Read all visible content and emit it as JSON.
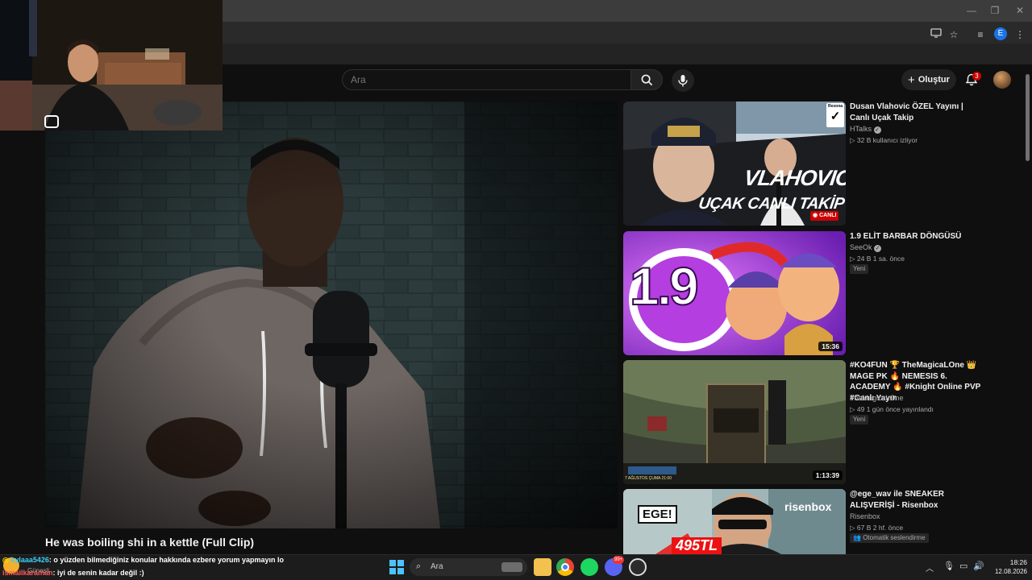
{
  "youtube": {
    "search": {
      "placeholder": "Ara"
    },
    "create_label": "Oluştur",
    "notifications_count": "3"
  },
  "browser": {
    "profile_initial": "E"
  },
  "main_video": {
    "title": "He was boiling shi in a kettle (Full Clip)"
  },
  "sidebar": {
    "videos": [
      {
        "title": "Dusan Vlahovic ÖZEL Yayını | Canlı Uçak Takip",
        "channel": "HTalks",
        "verified": true,
        "meta": "32 B kullanıcı izliyor",
        "thumb_text_1": "VLAHOVIC",
        "thumb_text_2": "UÇAK CANLI TAKİP",
        "live_label": "CANLI",
        "brand_text": "Rexona"
      },
      {
        "title": "1.9 ELİT BARBAR DÖNGÜSÜ",
        "channel": "SeeOk",
        "verified": true,
        "meta": "24 B   1 sa. önce",
        "badge": "Yeni",
        "thumb_text": "1.9",
        "duration": "15:36"
      },
      {
        "title": "#KO4FUN 🏆 TheMagicaLOne 👑 MAGE PK 🔥 NEMESIS 6. ACADEMY 🔥 #Knight Online PVP #Canlı Yayın",
        "channel": "TheMagicaLOne",
        "meta": "49   1 gün önce yayınlandı",
        "badge": "Yeni",
        "duration": "1:13:39",
        "thumb_text": "7 AĞUSTOS ÇUMA 21:00"
      },
      {
        "title": "@ege_wav  ile SNEAKER ALIŞVERİŞİ - Risenbox",
        "channel": "Risenbox",
        "meta": "67 B   2 hf. önce",
        "badge": "Otomatik seslendirme",
        "thumb_text_1": "EGE!",
        "thumb_text_2": "risenbox",
        "thumb_text_3": "495TL"
      }
    ]
  },
  "chat": {
    "line1_user": "kylaaa5426",
    "line1_text": ": o yüzden bilmediğiniz konular hakkında ezbere yorum yapmayın lo",
    "line2_user": "ismailkaraman",
    "line2_text": ": iyi de senin kadar değil :)",
    "weather_label": "Güneşli"
  },
  "taskbar": {
    "search_placeholder": "Ara",
    "time": "18:26",
    "date": "12.08.2026",
    "discord_badge": "99+"
  },
  "colors": {
    "accent_red": "#cc0000",
    "bg": "#0f0f0f",
    "text": "#f1f1f1",
    "muted": "#aaaaaa"
  }
}
